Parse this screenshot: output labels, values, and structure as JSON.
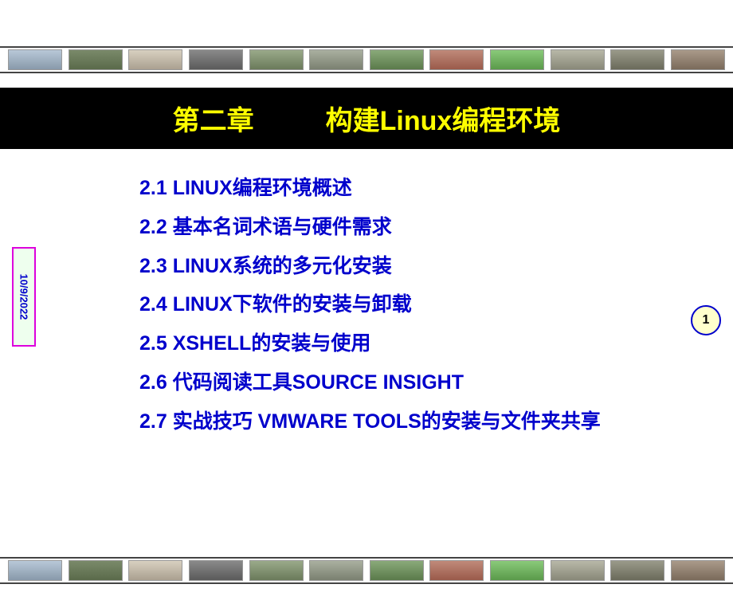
{
  "title": {
    "chapter": "第二章",
    "name": "构建Linux编程环境"
  },
  "toc": [
    "2.1 LINUX编程环境概述",
    "2.2 基本名词术语与硬件需求",
    "2.3  LINUX系统的多元化安装",
    "2.4 LINUX下软件的安装与卸载",
    "2.5 XSHELL的安装与使用",
    "2.6 代码阅读工具SOURCE INSIGHT",
    "2.7 实战技巧 VMWARE TOOLS的安装与文件夹共享"
  ],
  "date": "10/9/2022",
  "page_number": "1",
  "thumbnail_count": 12
}
